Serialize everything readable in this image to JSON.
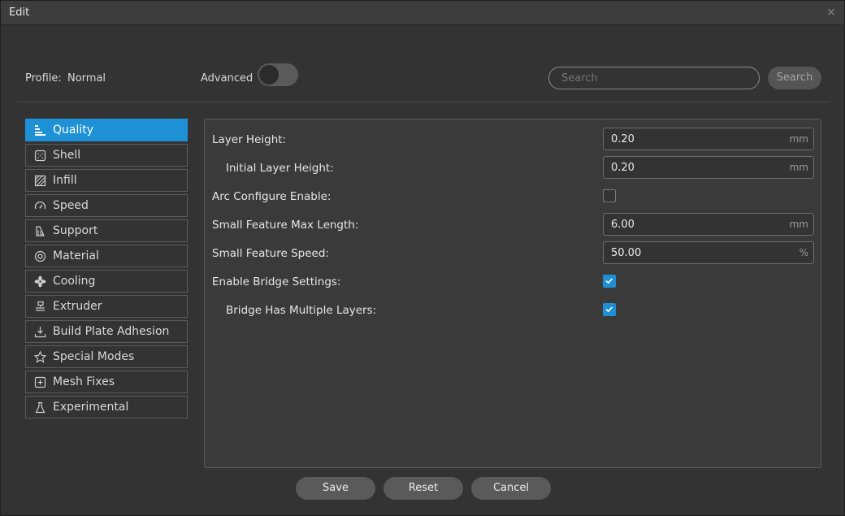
{
  "window": {
    "title": "Edit",
    "close_glyph": "×"
  },
  "toolbar": {
    "profile_label": "Profile:",
    "profile_value": "Normal",
    "advanced_label": "Advanced",
    "advanced_on": false,
    "search_placeholder": "Search",
    "search_button": "Search"
  },
  "sidebar": {
    "items": [
      {
        "label": "Quality",
        "icon": "quality-icon",
        "active": true
      },
      {
        "label": "Shell",
        "icon": "shell-icon"
      },
      {
        "label": "Infill",
        "icon": "infill-icon"
      },
      {
        "label": "Speed",
        "icon": "speed-icon"
      },
      {
        "label": "Support",
        "icon": "support-icon"
      },
      {
        "label": "Material",
        "icon": "material-icon"
      },
      {
        "label": "Cooling",
        "icon": "cooling-icon"
      },
      {
        "label": "Extruder",
        "icon": "extruder-icon"
      },
      {
        "label": "Build Plate Adhesion",
        "icon": "build-plate-icon"
      },
      {
        "label": "Special Modes",
        "icon": "star-icon"
      },
      {
        "label": "Mesh Fixes",
        "icon": "mesh-fixes-icon"
      },
      {
        "label": "Experimental",
        "icon": "flask-icon"
      }
    ]
  },
  "settings": [
    {
      "label": "Layer Height:",
      "type": "field",
      "value": "0.20",
      "unit": "mm"
    },
    {
      "label": "Initial Layer Height:",
      "type": "field",
      "value": "0.20",
      "unit": "mm"
    },
    {
      "label": "Arc Configure Enable:",
      "type": "checkbox",
      "checked": false
    },
    {
      "label": "Small Feature Max Length:",
      "type": "field",
      "value": "6.00",
      "unit": "mm"
    },
    {
      "label": "Small Feature Speed:",
      "type": "field",
      "value": "50.00",
      "unit": "%"
    },
    {
      "label": "Enable Bridge Settings:",
      "type": "checkbox",
      "checked": true
    },
    {
      "label": "Bridge Has Multiple Layers:",
      "type": "checkbox",
      "checked": true
    }
  ],
  "buttons": {
    "save": "Save",
    "reset": "Reset",
    "cancel": "Cancel"
  },
  "colors": {
    "accent": "#1e90d6",
    "background": "#333333",
    "panel": "#3a3a3a"
  }
}
